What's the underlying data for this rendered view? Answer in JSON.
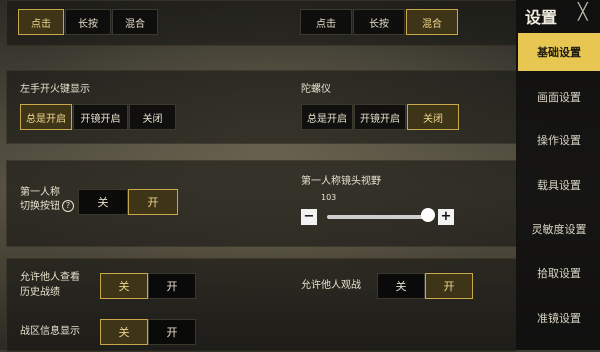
{
  "top_row": {
    "left_options": [
      "点击",
      "长按",
      "混合"
    ],
    "left_selected": 0,
    "right_options": [
      "点击",
      "长按",
      "混合"
    ],
    "right_selected": 2
  },
  "left_fire": {
    "label": "左手开火键显示",
    "options": [
      "总是开启",
      "开镜开启",
      "关闭"
    ],
    "selected": 0
  },
  "gyro": {
    "label": "陀螺仪",
    "options": [
      "总是开启",
      "开镜开启",
      "关闭"
    ],
    "selected": 2
  },
  "fpp_switch": {
    "label_line1": "第一人称",
    "label_line2": "切换按钮",
    "help": "?",
    "off": "关",
    "on": "开",
    "state": "on"
  },
  "fpp_fov": {
    "label": "第一人称镜头视野",
    "value": "103",
    "min_btn": "−",
    "plus_btn": "+",
    "level": 1.0
  },
  "history": {
    "label_line1": "允许他人查看",
    "label_line2": "历史战绩",
    "off": "关",
    "on": "开",
    "state": "off"
  },
  "spectate": {
    "label": "允许他人观战",
    "off": "关",
    "on": "开",
    "state": "on"
  },
  "zone_info": {
    "label": "战区信息显示",
    "off": "关",
    "on": "开",
    "state": "off"
  },
  "sidebar": {
    "title": "设置",
    "close": "╳",
    "items": [
      "基础设置",
      "画面设置",
      "操作设置",
      "载具设置",
      "灵敏度设置",
      "拾取设置",
      "准镜设置"
    ],
    "active": 0
  }
}
